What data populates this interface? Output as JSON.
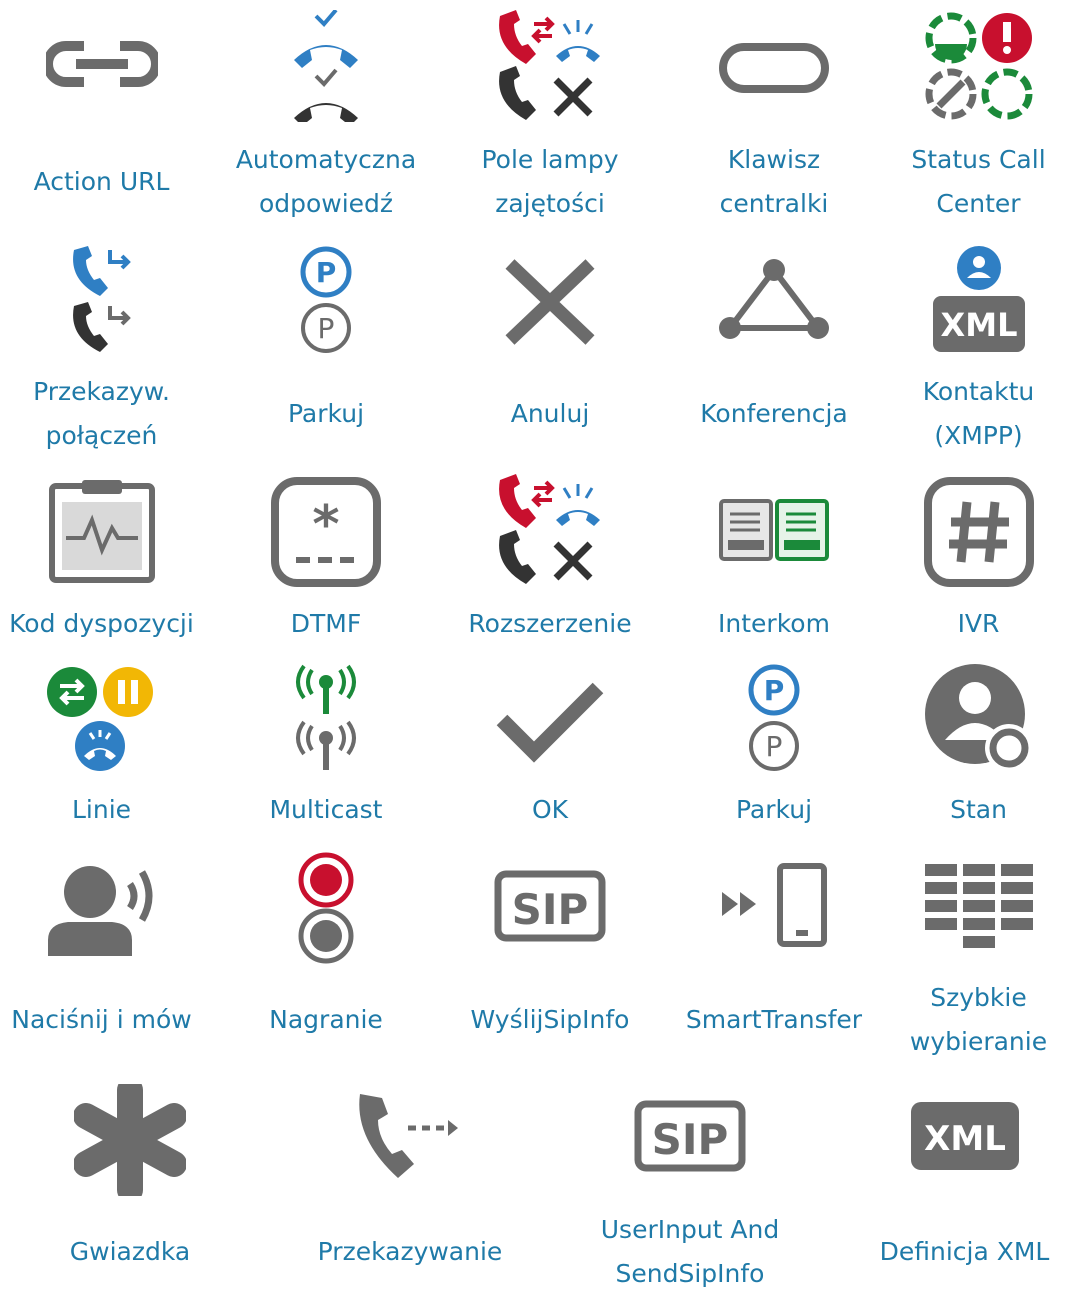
{
  "colors": {
    "label": "#1f7aa8",
    "grey": "#6b6b6b",
    "blue": "#2f7fc4",
    "red": "#c8102e",
    "green": "#1b8a3a",
    "yellow": "#f2b705"
  },
  "items": [
    {
      "label": "Action URL",
      "icon": "link-icon"
    },
    {
      "label": "Automatyczna\nodpowiedź",
      "icon": "auto-answer-icon"
    },
    {
      "label": "Pole lampy\nzajętości",
      "icon": "busy-lamp-field-icon"
    },
    {
      "label": "Klawisz\ncentralki",
      "icon": "pbx-key-icon"
    },
    {
      "label": "Status Call\nCenter",
      "icon": "call-center-status-icon"
    },
    {
      "label": "Przekazyw.\npołączeń",
      "icon": "call-forward-icon"
    },
    {
      "label": "Parkuj",
      "icon": "park-icon"
    },
    {
      "label": "Anuluj",
      "icon": "cancel-icon"
    },
    {
      "label": "Konferencja",
      "icon": "conference-icon"
    },
    {
      "label": "Kontaktu\n(XMPP)",
      "icon": "xmpp-contact-icon"
    },
    {
      "label": "Kod dyspozycji",
      "icon": "disposition-code-icon"
    },
    {
      "label": "DTMF",
      "icon": "dtmf-icon"
    },
    {
      "label": "Rozszerzenie",
      "icon": "extension-icon"
    },
    {
      "label": "Interkom",
      "icon": "intercom-icon"
    },
    {
      "label": "IVR",
      "icon": "ivr-icon"
    },
    {
      "label": "Linie",
      "icon": "lines-icon"
    },
    {
      "label": "Multicast",
      "icon": "multicast-icon"
    },
    {
      "label": "OK",
      "icon": "check-icon"
    },
    {
      "label": "Parkuj",
      "icon": "park-icon"
    },
    {
      "label": "Stan",
      "icon": "status-icon"
    },
    {
      "label": "Naciśnij i mów",
      "icon": "push-to-talk-icon"
    },
    {
      "label": "Nagranie",
      "icon": "record-icon"
    },
    {
      "label": "WyślijSipInfo",
      "icon": "sip-icon"
    },
    {
      "label": "SmartTransfer",
      "icon": "smart-transfer-icon"
    },
    {
      "label": "Szybkie\nwybieranie",
      "icon": "speed-dial-icon"
    },
    {
      "label": "Gwiazdka",
      "icon": "star-icon"
    },
    {
      "label": "Przekazywanie",
      "icon": "transfer-icon"
    },
    {
      "label": "UserInput And\nSendSipInfo",
      "icon": "sip-icon"
    },
    {
      "label": "Definicja XML",
      "icon": "xml-icon"
    }
  ]
}
